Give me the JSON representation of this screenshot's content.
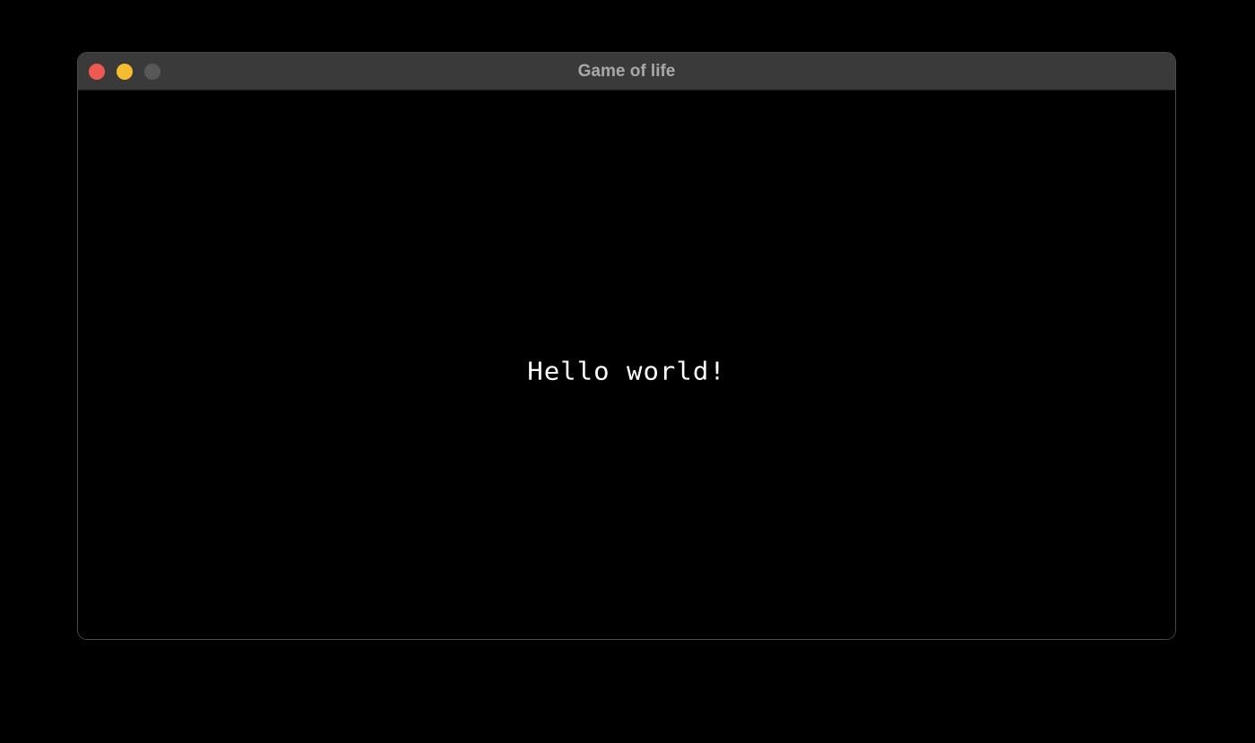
{
  "window": {
    "title": "Game of life",
    "controls": {
      "close_color": "#ee5a52",
      "minimize_color": "#f5bd2f",
      "zoom_color": "#585858"
    }
  },
  "content": {
    "message": "Hello world!",
    "background_color": "#000000",
    "text_color": "#ffffff"
  },
  "icons": {
    "close": "close-icon",
    "minimize": "minimize-icon",
    "zoom": "zoom-icon"
  }
}
